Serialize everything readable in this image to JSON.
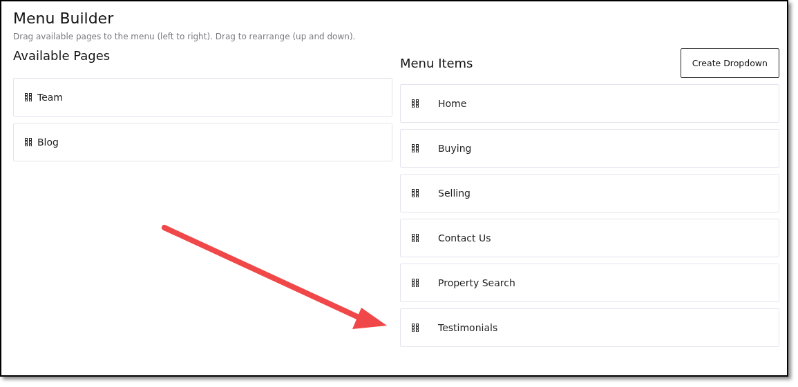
{
  "title": "Menu Builder",
  "subtitle": "Drag available pages to the menu (left to right). Drag to rearrange (up and down).",
  "available_pages": {
    "heading": "Available Pages",
    "items": [
      {
        "label": "Team"
      },
      {
        "label": "Blog"
      }
    ]
  },
  "menu_items": {
    "heading": "Menu Items",
    "button": "Create Dropdown",
    "items": [
      {
        "label": "Home"
      },
      {
        "label": "Buying"
      },
      {
        "label": "Selling"
      },
      {
        "label": "Contact Us"
      },
      {
        "label": "Property Search"
      },
      {
        "label": "Testimonials"
      }
    ]
  }
}
